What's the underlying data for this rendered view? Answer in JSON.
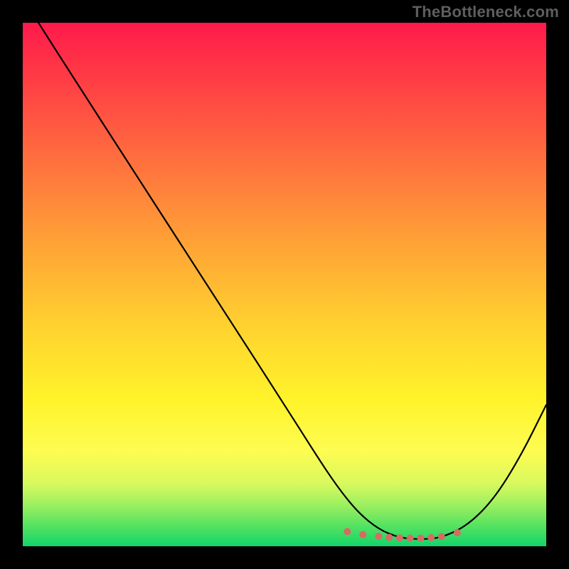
{
  "watermark": "TheBottleneck.com",
  "colors": {
    "background": "#000000",
    "curve": "#000000",
    "dots": "#d96a63",
    "gradient_top": "#ff1a4b",
    "gradient_bottom": "#12d568"
  },
  "chart_data": {
    "type": "line",
    "title": "",
    "xlabel": "",
    "ylabel": "",
    "xlim": [
      0,
      100
    ],
    "ylim": [
      0,
      100
    ],
    "grid": false,
    "series": [
      {
        "name": "bottleneck-curve",
        "x": [
          3,
          10,
          20,
          30,
          40,
          50,
          56,
          60,
          64,
          68,
          72,
          76,
          80,
          85,
          90,
          95,
          100
        ],
        "y": [
          100,
          89,
          73.5,
          58,
          42.5,
          27,
          17.5,
          11.5,
          6.5,
          3.2,
          1.6,
          1.3,
          1.6,
          4.0,
          9.0,
          17.0,
          27.0
        ]
      }
    ],
    "markers": {
      "name": "valley-dots",
      "x": [
        62,
        65,
        68,
        70,
        72,
        74,
        76,
        78,
        80,
        83
      ],
      "y": [
        2.8,
        2.2,
        1.9,
        1.7,
        1.6,
        1.55,
        1.55,
        1.65,
        1.85,
        2.6
      ]
    },
    "gradient_stops": [
      {
        "pos": 0.0,
        "hex": "#ff1a4b"
      },
      {
        "pos": 0.1,
        "hex": "#ff3a45"
      },
      {
        "pos": 0.25,
        "hex": "#ff6b3f"
      },
      {
        "pos": 0.42,
        "hex": "#ffa236"
      },
      {
        "pos": 0.58,
        "hex": "#ffd22f"
      },
      {
        "pos": 0.72,
        "hex": "#fff32a"
      },
      {
        "pos": 0.82,
        "hex": "#fdfc52"
      },
      {
        "pos": 0.88,
        "hex": "#d8f95e"
      },
      {
        "pos": 0.92,
        "hex": "#9ef060"
      },
      {
        "pos": 0.96,
        "hex": "#57e261"
      },
      {
        "pos": 1.0,
        "hex": "#12d568"
      }
    ]
  }
}
